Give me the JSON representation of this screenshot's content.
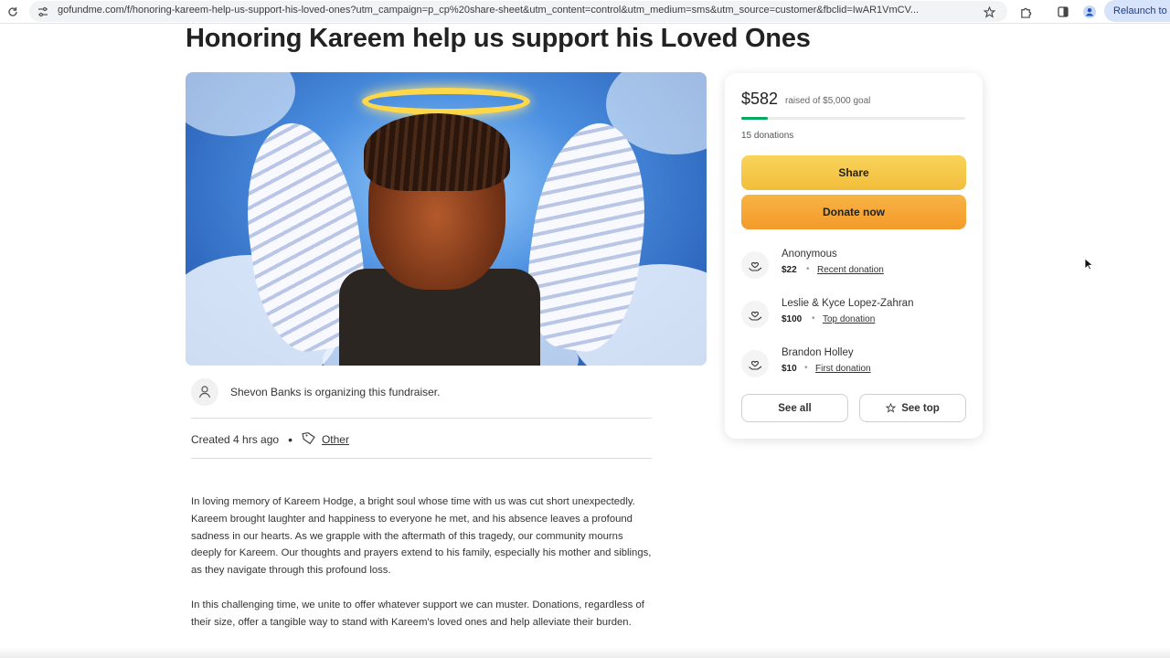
{
  "browser": {
    "url": "gofundme.com/f/honoring-kareem-help-us-support-his-loved-ones?utm_campaign=p_cp%20share-sheet&utm_content=control&utm_medium=sms&utm_source=customer&fbclid=IwAR1VmCV...",
    "relaunch_label": "Relaunch to"
  },
  "page": {
    "title": "Honoring Kareem help us support his Loved Ones"
  },
  "organizer": {
    "text": "Shevon Banks is organizing this fundraiser."
  },
  "meta": {
    "created": "Created 4 hrs ago",
    "separator": "•",
    "category": "Other"
  },
  "story": {
    "paragraphs": [
      "In loving memory of Kareem Hodge, a bright soul whose time with us was cut short unexpectedly. Kareem brought laughter and happiness to everyone he met, and his absence leaves a profound sadness in our hearts. As we grapple with the aftermath of this tragedy, our community mourns deeply for Kareem. Our thoughts and prayers extend to his family, especially his mother and siblings, as they navigate through this profound loss.",
      "In this challenging time, we unite to offer whatever support we can muster. Donations, regardless of their size, offer a tangible way to stand with Kareem's loved ones and help alleviate their burden."
    ]
  },
  "donation_card": {
    "raised": "$582",
    "goal_text": "raised of $5,000 goal",
    "progress_fraction": 0.1164,
    "donation_count": "15 donations",
    "share_label": "Share",
    "donate_label": "Donate now",
    "donors": [
      {
        "name": "Anonymous",
        "amount": "$22",
        "label": "Recent donation"
      },
      {
        "name": "Leslie & Kyce Lopez-Zahran",
        "amount": "$100",
        "label": "Top donation"
      },
      {
        "name": "Brandon Holley",
        "amount": "$10",
        "label": "First donation"
      }
    ],
    "separator": "•",
    "see_all_label": "See all",
    "see_top_label": "See top"
  },
  "colors": {
    "progress": "#02a95c",
    "share_button": "#f6c94a",
    "donate_button": "#f5a733"
  },
  "icons": {
    "reload": "reload-icon",
    "site_settings": "site-settings-icon",
    "bookmark": "star-icon",
    "extensions": "puzzle-icon",
    "side_panel": "side-panel-icon",
    "profile": "profile-icon",
    "organizer": "person-icon",
    "category": "tag-icon",
    "donor": "heart-hand-icon",
    "see_top": "star-outline-icon"
  }
}
